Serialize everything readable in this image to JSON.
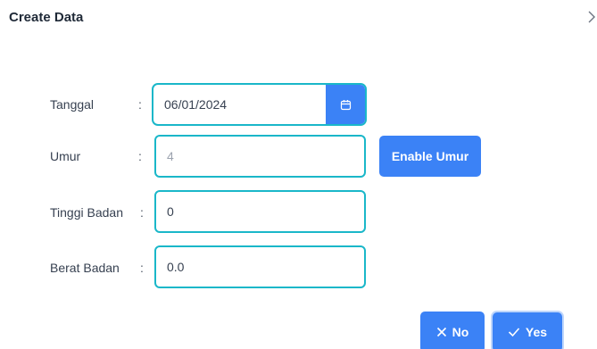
{
  "dialog": {
    "title": "Create Data",
    "close_icon": "chevron-right-icon"
  },
  "form": {
    "tanggal": {
      "label": "Tanggal",
      "colon": ":",
      "value": "06/01/2024",
      "button_icon": "calendar-icon"
    },
    "umur": {
      "label": "Umur",
      "colon": ":",
      "value": "4",
      "disabled": true,
      "enable_button_label": "Enable Umur"
    },
    "tinggi_badan": {
      "label": "Tinggi Badan",
      "colon": ":",
      "value": "0"
    },
    "berat_badan": {
      "label": "Berat Badan",
      "colon": ":",
      "value": "0.0"
    }
  },
  "footer": {
    "no_label": "No",
    "no_icon": "close-icon",
    "yes_label": "Yes",
    "yes_icon": "check-icon"
  },
  "colors": {
    "primary": "#3b82f6",
    "field_border": "#1ab7c9"
  }
}
